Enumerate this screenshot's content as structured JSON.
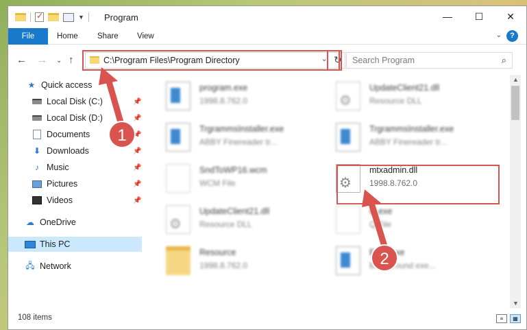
{
  "window": {
    "title": "Program",
    "controls": {
      "minimize": "—",
      "maximize": "☐",
      "close": "✕"
    }
  },
  "ribbon": {
    "tabs": [
      "File",
      "Home",
      "Share",
      "View"
    ],
    "help": "?"
  },
  "address": {
    "path": "C:\\Program Files\\Program Directory",
    "search_placeholder": "Search Program"
  },
  "nav": {
    "items": [
      {
        "label": "Quick access",
        "icon": "star-icon"
      },
      {
        "label": "Local Disk (C:)",
        "icon": "disk-icon",
        "pinned": true
      },
      {
        "label": "Local Disk (D:)",
        "icon": "disk-icon",
        "pinned": true
      },
      {
        "label": "Documents",
        "icon": "documents-icon",
        "pinned": true
      },
      {
        "label": "Downloads",
        "icon": "downloads-icon",
        "pinned": true
      },
      {
        "label": "Music",
        "icon": "music-icon",
        "pinned": true
      },
      {
        "label": "Pictures",
        "icon": "pictures-icon",
        "pinned": true
      },
      {
        "label": "Videos",
        "icon": "videos-icon",
        "pinned": true
      },
      {
        "label": "OneDrive",
        "icon": "onedrive-icon"
      },
      {
        "label": "This PC",
        "icon": "this-pc-icon",
        "selected": true
      },
      {
        "label": "Network",
        "icon": "network-icon"
      }
    ]
  },
  "files": [
    {
      "name": "program.exe",
      "sub": "1998.8.762.0",
      "icon": "exe-icon",
      "blurred": true
    },
    {
      "name": "UpdateClient21.dll",
      "sub": "Resource DLL",
      "icon": "dll-icon",
      "blurred": true
    },
    {
      "name": "TrgrammsInstaller.exe",
      "sub": "ABBY Finereader tr...",
      "icon": "exe-icon",
      "blurred": true
    },
    {
      "name": "TrgrammsInstaller.exe",
      "sub": "ABBY Finereader tr...",
      "icon": "exe-icon",
      "blurred": true
    },
    {
      "name": "SndToWP16.wcm",
      "sub": "WCM File",
      "icon": "file-icon",
      "blurred": true
    },
    {
      "name": "mtxadmin.dll",
      "sub": "1998.8.762.0",
      "icon": "dll-icon",
      "blurred": false
    },
    {
      "name": "UpdateClient21.dll",
      "sub": "Resource DLL",
      "icon": "dll-icon",
      "blurred": true
    },
    {
      "name": "Q.exe",
      "sub": "Q File",
      "icon": "file-icon",
      "blurred": true
    },
    {
      "name": "Resource",
      "sub": "1998.8.762.0",
      "icon": "folder-icon",
      "blurred": true
    },
    {
      "name": "Exec.exe",
      "sub": "Background exe...",
      "icon": "exe-icon",
      "blurred": true
    }
  ],
  "status": {
    "items": "108 items"
  },
  "annotations": [
    "1",
    "2"
  ],
  "colors": {
    "accent": "#1979ca",
    "highlight": "#d9534f",
    "selected": "#cce8ff"
  }
}
